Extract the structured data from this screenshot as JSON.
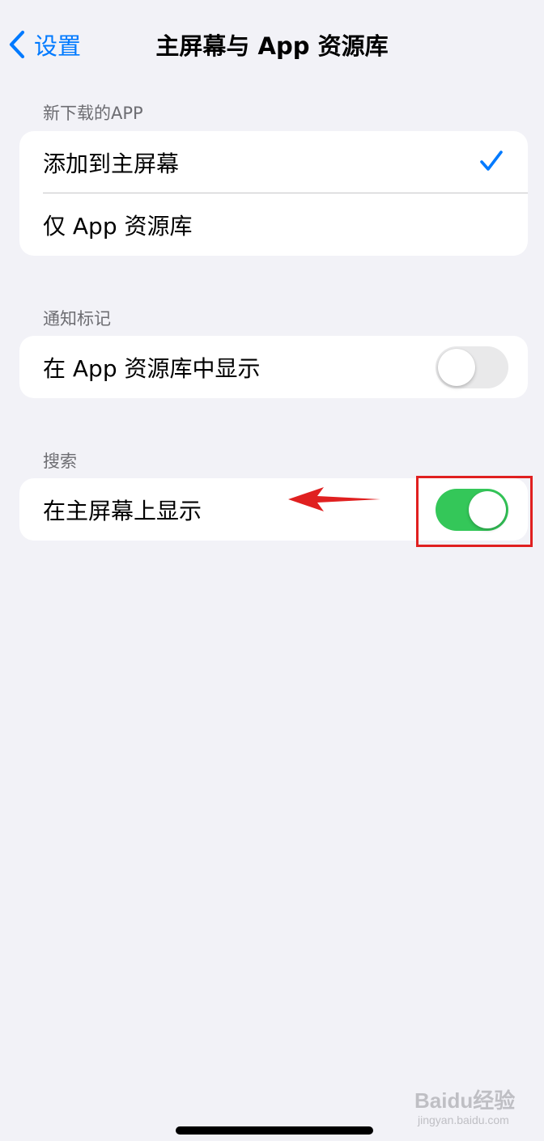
{
  "nav": {
    "back_label": "设置",
    "title": "主屏幕与 App 资源库"
  },
  "sections": {
    "new_downloads": {
      "header": "新下载的APP",
      "items": [
        {
          "label": "添加到主屏幕",
          "selected": true
        },
        {
          "label": "仅 App 资源库",
          "selected": false
        }
      ]
    },
    "badges": {
      "header": "通知标记",
      "items": [
        {
          "label": "在 App 资源库中显示",
          "toggle": "off"
        }
      ]
    },
    "search": {
      "header": "搜索",
      "items": [
        {
          "label": "在主屏幕上显示",
          "toggle": "on"
        }
      ]
    }
  },
  "watermark": {
    "logo": "Baidu经验",
    "sub": "jingyan.baidu.com"
  },
  "colors": {
    "accent": "#007aff",
    "toggle_on": "#34c759",
    "toggle_off": "#e9e9ea",
    "annotation": "#e02020",
    "background": "#f2f2f7"
  },
  "icons": {
    "back": "chevron-left-icon",
    "check": "checkmark-icon",
    "annotation_arrow": "arrow-left-icon"
  }
}
